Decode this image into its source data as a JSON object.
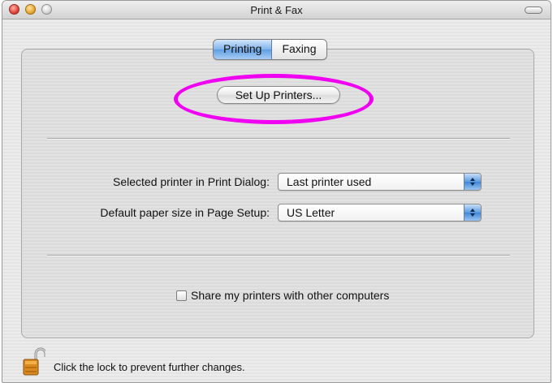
{
  "window": {
    "title": "Print & Fax"
  },
  "tabs": [
    {
      "label": "Printing",
      "selected": true
    },
    {
      "label": "Faxing",
      "selected": false
    }
  ],
  "setup_button": {
    "label": "Set Up Printers..."
  },
  "selected_printer": {
    "label": "Selected printer in Print Dialog:",
    "value": "Last printer used"
  },
  "paper_size": {
    "label": "Default paper size in Page Setup:",
    "value": "US Letter"
  },
  "share": {
    "label": "Share my printers with other computers",
    "checked": false
  },
  "lock": {
    "text": "Click the lock to prevent further changes."
  },
  "colors": {
    "highlight": "#f000f0",
    "tab_selected": "#7fb3ea",
    "popup_arrows": "#3f86d8"
  }
}
